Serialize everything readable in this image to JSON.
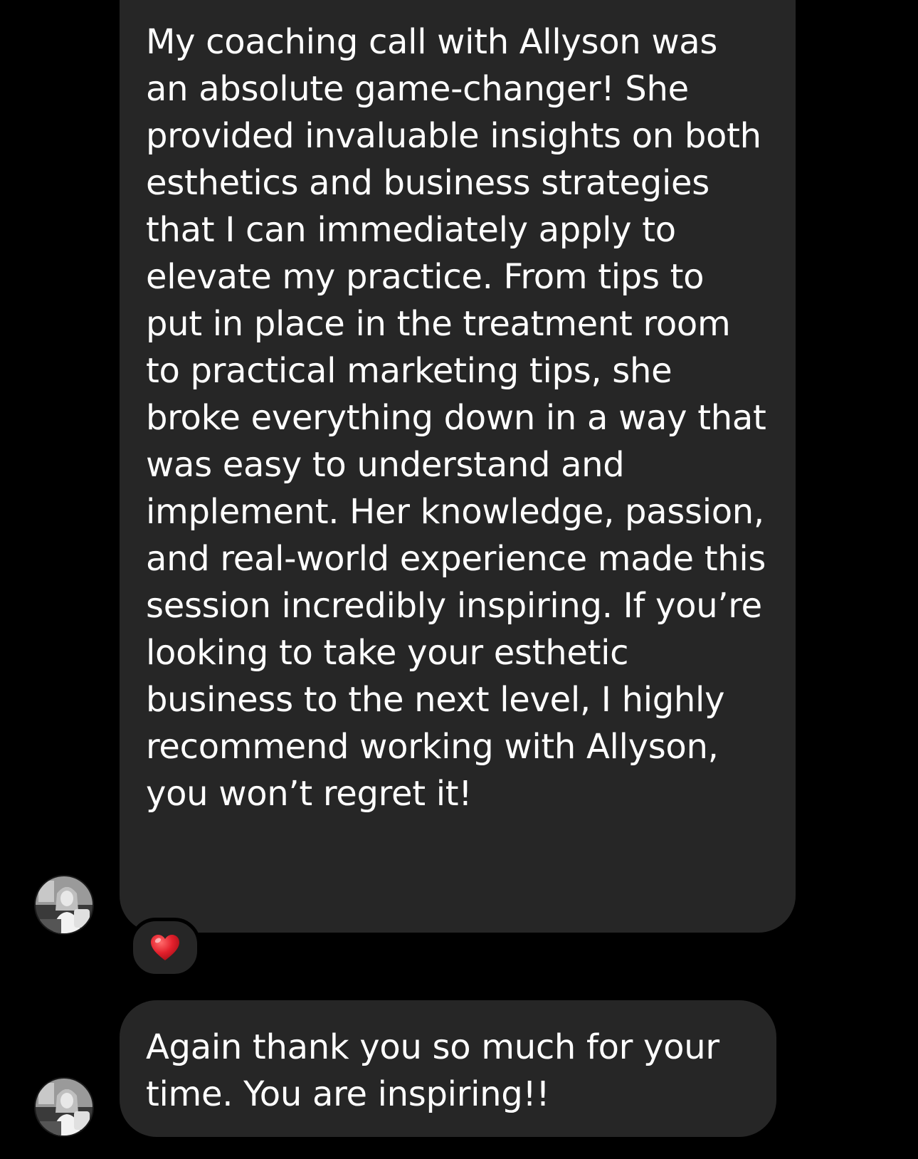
{
  "colors": {
    "background": "#000000",
    "bubble": "#262626",
    "text": "#ffffff",
    "heart": "#e3202c"
  },
  "messages": [
    {
      "text": "My coaching call with Allyson was an absolute game-changer! She provided invaluable insights on both esthetics and business strategies that I can immediately apply to elevate my practice. From tips to put in place in the treatment room to practical marketing tips, she broke everything down in a way that was easy to understand and implement. Her knowledge, passion, and real-world experience made this session incredibly inspiring. If you’re looking to take your esthetic business to the next level, I highly recommend working with Allyson, you won’t regret it!",
      "reaction": "heart-icon"
    },
    {
      "text": "Again thank you so much for your time. You are inspiring!!"
    }
  ]
}
